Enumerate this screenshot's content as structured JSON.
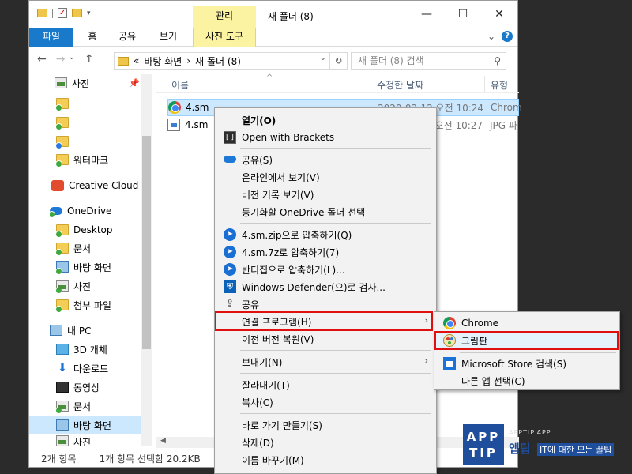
{
  "window": {
    "contextual_tab_group": "관리",
    "title": "새 폴더 (8)",
    "minimize": "—",
    "maximize": "☐",
    "close": "✕"
  },
  "ribbon": {
    "tabs": [
      "파일",
      "홈",
      "공유",
      "보기",
      "사진 도구"
    ],
    "expand": "⌄",
    "help": "?"
  },
  "address": {
    "back": "←",
    "forward": "→",
    "recent": "⌄",
    "up": "↑",
    "prefix": "«",
    "crumb1": "바탕 화면",
    "crumb_sep": "›",
    "crumb2": "새 폴더 (8)",
    "dropdown": "⌄",
    "refresh": "↻",
    "search_placeholder": "새 폴더 (8) 검색",
    "search_icon": "⚲"
  },
  "sidebar": {
    "pin": "📌",
    "items": [
      {
        "label": "사진",
        "icon": "picture-icon"
      },
      {
        "label": "",
        "icon": "folder-icon"
      },
      {
        "label": "",
        "icon": "folder-icon"
      },
      {
        "label": "",
        "icon": "folder-icon"
      },
      {
        "label": "워터마크",
        "icon": "folder-icon"
      },
      {
        "label": "Creative Cloud Fil",
        "icon": "creative-cloud-icon"
      },
      {
        "label": "OneDrive",
        "icon": "onedrive-icon"
      },
      {
        "label": "Desktop",
        "icon": "folder-icon"
      },
      {
        "label": "문서",
        "icon": "folder-icon"
      },
      {
        "label": "바탕 화면",
        "icon": "desktop-icon"
      },
      {
        "label": "사진",
        "icon": "picture-icon"
      },
      {
        "label": "첨부 파일",
        "icon": "folder-icon"
      },
      {
        "label": "내 PC",
        "icon": "pc-icon"
      },
      {
        "label": "3D 개체",
        "icon": "cube-icon"
      },
      {
        "label": "다운로드",
        "icon": "download-icon"
      },
      {
        "label": "동영상",
        "icon": "video-icon"
      },
      {
        "label": "문서",
        "icon": "document-icon"
      },
      {
        "label": "바탕 화면",
        "icon": "desktop-icon"
      },
      {
        "label": "사진",
        "icon": "picture-icon"
      }
    ]
  },
  "columns": {
    "name": "이름",
    "date": "수정한 날짜",
    "type": "유형",
    "sort_arrow": "^"
  },
  "files": [
    {
      "name": "4.sm",
      "date": "2020-02-12 오전 10:24",
      "type": "Chrom"
    },
    {
      "name": "4.sm",
      "date": "2020-02-12 오전 10:27",
      "type": "JPG 파"
    }
  ],
  "status": {
    "count": "2개 항목",
    "selected": "1개 항목 선택함 20.2KB"
  },
  "context_menu": {
    "items": [
      {
        "label": "열기(O)",
        "icon": ""
      },
      {
        "label": "Open with Brackets",
        "icon": "brackets-icon"
      },
      {
        "label": "공유(S)",
        "icon": "onedrive-icon"
      },
      {
        "label": "온라인에서 보기(V)",
        "icon": ""
      },
      {
        "label": "버전 기록 보기(V)",
        "icon": ""
      },
      {
        "label": "동기화할 OneDrive 폴더 선택",
        "icon": ""
      },
      {
        "label": "4.sm.zip으로 압축하기(Q)",
        "icon": "bandizip-icon"
      },
      {
        "label": "4.sm.7z로 압축하기(7)",
        "icon": "bandizip-icon"
      },
      {
        "label": "반디집으로 압축하기(L)...",
        "icon": "bandizip-icon"
      },
      {
        "label": "Windows Defender(으)로 검사...",
        "icon": "defender-icon"
      },
      {
        "label": "공유",
        "icon": "share-icon"
      },
      {
        "label": "연결 프로그램(H)",
        "icon": ""
      },
      {
        "label": "이전 버전 복원(V)",
        "icon": ""
      },
      {
        "label": "보내기(N)",
        "icon": ""
      },
      {
        "label": "잘라내기(T)",
        "icon": ""
      },
      {
        "label": "복사(C)",
        "icon": ""
      },
      {
        "label": "바로 가기 만들기(S)",
        "icon": ""
      },
      {
        "label": "삭제(D)",
        "icon": ""
      },
      {
        "label": "이름 바꾸기(M)",
        "icon": ""
      }
    ],
    "submenu_arrow": "›"
  },
  "open_with_menu": {
    "items": [
      {
        "label": "Chrome",
        "icon": "chrome-icon"
      },
      {
        "label": "그림판",
        "icon": "paint-icon"
      },
      {
        "label": "Microsoft Store 검색(S)",
        "icon": "store-icon"
      },
      {
        "label": "다른 앱 선택(C)",
        "icon": ""
      }
    ]
  },
  "watermark": {
    "logo_line1": "APP",
    "logo_line2": "TIP",
    "domain": "APPTIP.APP",
    "brand": "앱팁",
    "tagline": "IT에 대한 모든 꿀팁"
  },
  "colors": {
    "accent": "#1979ca",
    "highlight_border": "#e01010",
    "ribbon_context": "#fbf2a2"
  }
}
